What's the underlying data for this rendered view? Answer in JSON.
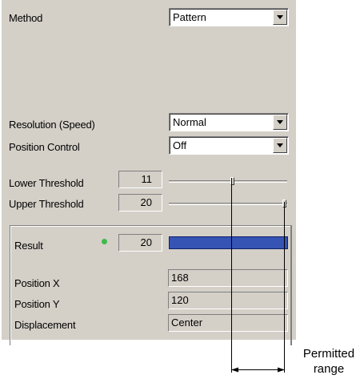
{
  "fields": {
    "method": {
      "label": "Method",
      "value": "Pattern"
    },
    "resolution": {
      "label": "Resolution (Speed)",
      "value": "Normal"
    },
    "position_control": {
      "label": "Position Control",
      "value": "Off"
    },
    "lower_threshold": {
      "label": "Lower Threshold",
      "value": "11"
    },
    "upper_threshold": {
      "label": "Upper Threshold",
      "value": "20"
    }
  },
  "result_group": {
    "result": {
      "label": "Result",
      "value": "20",
      "indicator_color": "#3fba4a",
      "bar_color": "#3554b4"
    },
    "position_x": {
      "label": "Position X",
      "value": "168"
    },
    "position_y": {
      "label": "Position Y",
      "value": "120"
    },
    "displacement": {
      "label": "Displacement",
      "value": "Center"
    }
  },
  "annotation": {
    "line1": "Permitted",
    "line2": "range"
  },
  "colors": {
    "panel": "#d4d0c8"
  }
}
